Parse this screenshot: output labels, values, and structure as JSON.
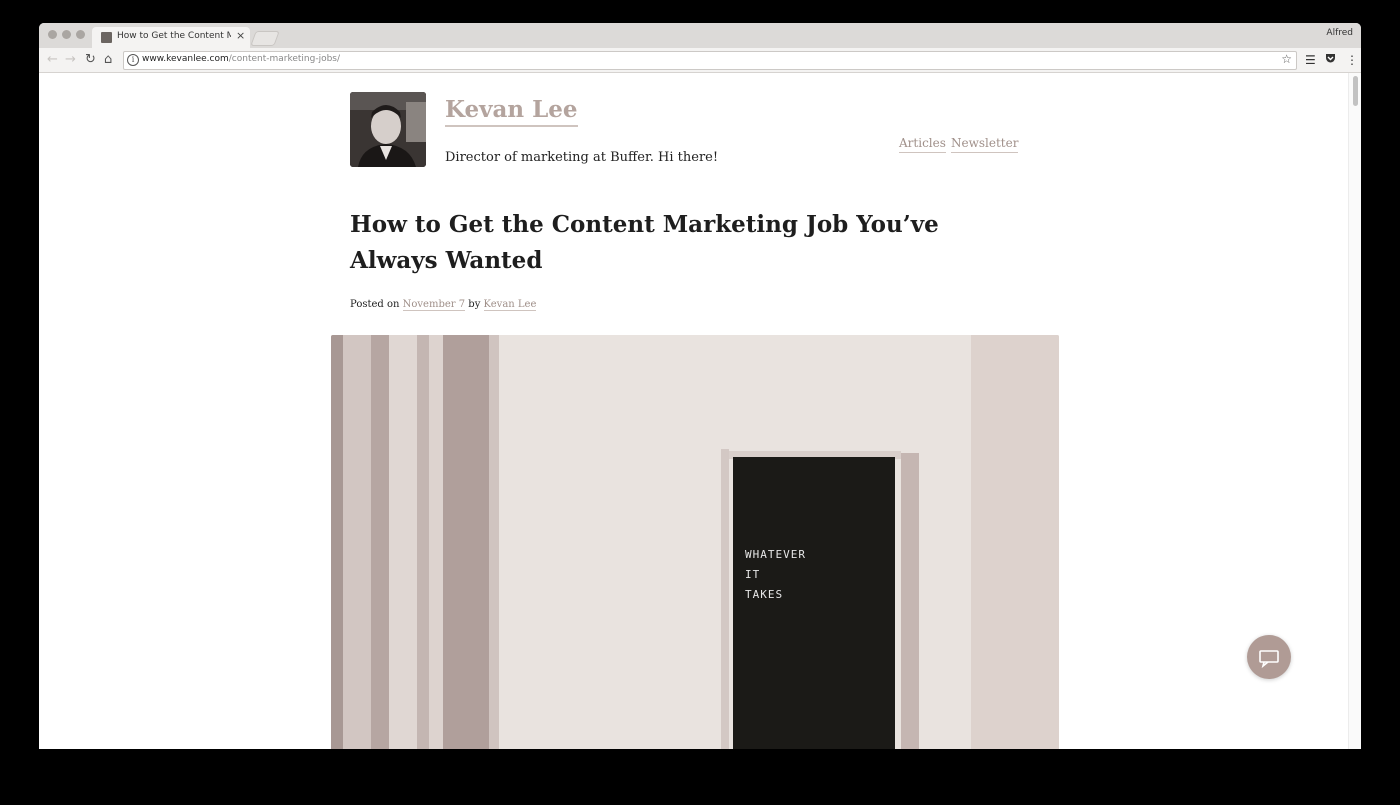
{
  "browser": {
    "tab_title": "How to Get the Content Marketing Jobs",
    "tab_close": "×",
    "profile_name": "Alfred",
    "url_domain": "www.kevanlee.com",
    "url_path": "/content-marketing-jobs/",
    "info_icon": "i",
    "nav_icons": [
      "back-arrow-icon",
      "forward-arrow-icon",
      "reload-icon",
      "home-icon"
    ],
    "extension_icons": [
      "buffer-icon",
      "pocket-icon",
      "menu-dots-icon"
    ]
  },
  "site": {
    "name": "Kevan Lee",
    "tagline": "Director of marketing at Buffer. Hi there!",
    "nav": [
      {
        "label": "Articles"
      },
      {
        "label": "Newsletter"
      }
    ]
  },
  "post": {
    "title": "How to Get the Content Marketing Job You’ve Always Wanted",
    "posted_on_prefix": "Posted on",
    "date": "November 7",
    "by_word": "by",
    "author": "Kevan Lee"
  },
  "hero": {
    "door_text": [
      "WHATEVER",
      "IT",
      "TAKES"
    ]
  },
  "colors": {
    "accent_link": "#b4a49e",
    "link_underline": "#cfc4bf",
    "fab": "#b09b95",
    "window_background": "#000000"
  },
  "fab": {
    "icon": "chat-bubble-icon"
  }
}
